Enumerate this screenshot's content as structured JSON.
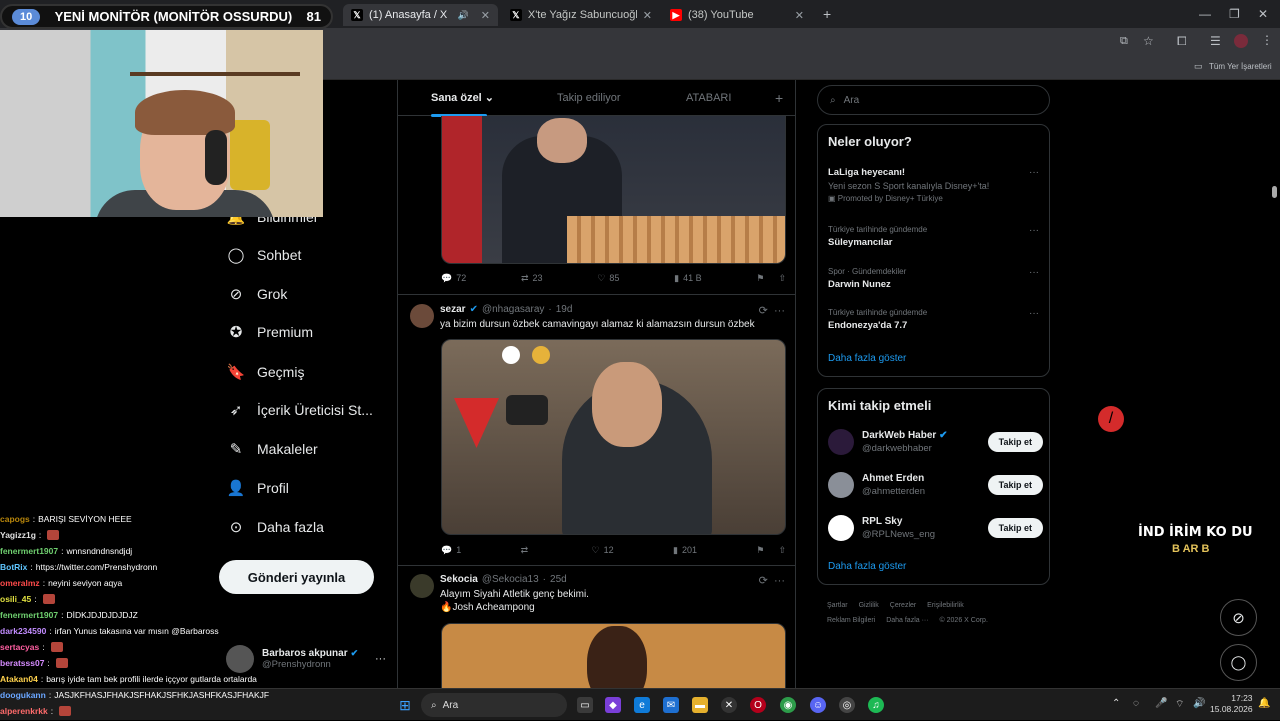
{
  "stream": {
    "title": "YENİ MONİTÖR (MONİTÖR OSSURDU)",
    "level": "10",
    "count": "81",
    "right_text_line1": "İND İRİM KO DU",
    "right_text_line2": "B AR B"
  },
  "browser": {
    "tabs": [
      {
        "label": "(1) Anasayfa / X",
        "icon": "x-logo-icon"
      },
      {
        "label": "X'te Yağız Sabuncuoğlu: \"ÖZEL",
        "icon": "x-logo-icon"
      },
      {
        "label": "(38) YouTube",
        "icon": "youtube-icon"
      }
    ],
    "bookmarks_label": "Tüm Yer İşaretleri"
  },
  "sidebar": {
    "items": [
      {
        "label": "Bildirimler",
        "icon": "bell-icon"
      },
      {
        "label": "Sohbet",
        "icon": "chat-icon"
      },
      {
        "label": "Grok",
        "icon": "grok-icon"
      },
      {
        "label": "Premium",
        "icon": "premium-icon"
      },
      {
        "label": "Geçmiş",
        "icon": "bookmark-icon"
      },
      {
        "label": "İçerik Üreticisi St...",
        "icon": "rocket-icon"
      },
      {
        "label": "Makaleler",
        "icon": "article-icon"
      },
      {
        "label": "Profil",
        "icon": "profile-icon"
      },
      {
        "label": "Daha fazla",
        "icon": "more-circle-icon"
      }
    ],
    "post_button": "Gönderi yayınla",
    "account": {
      "name": "Barbaros akpunar",
      "handle": "@Prenshydronn"
    }
  },
  "feed": {
    "tabs": [
      "Sana özel",
      "Takip ediliyor",
      "ATABARI"
    ],
    "tweets": [
      {
        "actions": {
          "replies": "72",
          "retweets": "23",
          "likes": "85",
          "views": "41 B"
        }
      },
      {
        "name": "sezar",
        "handle": "@nhagasaray",
        "time": "19d",
        "text": "ya bizim dursun özbek camavingayı alamaz ki alamazsın dursun özbek",
        "actions": {
          "replies": "1",
          "retweets": "",
          "likes": "12",
          "views": "201"
        }
      },
      {
        "name": "Sekocia",
        "handle": "@Sekocia13",
        "time": "25d",
        "text_line1": "Alayım Siyahi Atletik genç bekimi.",
        "text_line2": "Josh Acheampong"
      }
    ]
  },
  "search": {
    "placeholder": "Ara"
  },
  "trends": {
    "title": "Neler oluyor?",
    "items": [
      {
        "category": "",
        "title": "LaLiga heyecanı!",
        "subtitle": "Yeni sezon S Sport kanalıyla Disney+'ta!",
        "promo": "Promoted by Disney+ Türkiye"
      },
      {
        "category": "Türkiye tarihinde gündemde",
        "title": "Süleymancılar"
      },
      {
        "category": "Spor · Gündemdekiler",
        "title": "Darwin Nunez"
      },
      {
        "category": "Türkiye tarihinde gündemde",
        "title": "Endonezya'da 7.7"
      }
    ],
    "show_more": "Daha fazla göster"
  },
  "who_to_follow": {
    "title": "Kimi takip etmeli",
    "accounts": [
      {
        "name": "DarkWeb Haber",
        "handle": "@darkwebhaber",
        "button": "Takip et",
        "verified": true
      },
      {
        "name": "Ahmet Erden",
        "handle": "@ahmetterden",
        "button": "Takip et"
      },
      {
        "name": "RPL Sky",
        "handle": "@RPLNews_eng",
        "button": "Takip et"
      }
    ],
    "show_more": "Daha fazla göster"
  },
  "footer": {
    "links": [
      "Şartlar",
      "Gizlilik",
      "Çerezler",
      "Erişilebilirlik",
      "Reklam Bilgileri",
      "Daha fazla ···",
      "© 2026 X Corp."
    ]
  },
  "chat": {
    "messages": [
      {
        "user": "capogs",
        "text": "BARIŞI SEVİYON HEEE",
        "color": "#b8860b"
      },
      {
        "user": "Yagizz1g",
        "text": "",
        "color": "#e0e0e0"
      },
      {
        "user": "fenermert1907",
        "text": "wnnsndndnsndjdj",
        "color": "#6fcf6f"
      },
      {
        "user": "BotRix",
        "text": "https://twitter.com/Prenshydronn",
        "color": "#5fc6ff"
      },
      {
        "user": "omeralmz",
        "text": "neyini seviyon aqya",
        "color": "#ff4b4b"
      },
      {
        "user": "osili_45",
        "text": "",
        "color": "#e0e040"
      },
      {
        "user": "fenermert1907",
        "text": "DİDKJDJDJDJDJZ",
        "color": "#6fcf6f"
      },
      {
        "user": "dark234590",
        "text": "irfan Yunus takasına var mısın @Barbaross",
        "color": "#c28cff"
      },
      {
        "user": "sertacyas",
        "text": "",
        "color": "#ff5fa2"
      },
      {
        "user": "beratsss07",
        "text": "",
        "color": "#d68cff"
      },
      {
        "user": "Atakan04",
        "text": "barış iyide tam bek profili ilerde iççyor gutlarda ortalarda",
        "color": "#ffd24d"
      },
      {
        "user": "doogukann",
        "text": "JASJKFHASJFHAKJSFHAKJSFHKJASHFKASJFHAKJF",
        "color": "#6aa6ff"
      },
      {
        "user": "alperenkrkk",
        "text": "",
        "color": "#ff6b6b"
      }
    ]
  },
  "taskbar": {
    "search": "Ara",
    "time": "17:23",
    "date": "15.08.2026"
  }
}
